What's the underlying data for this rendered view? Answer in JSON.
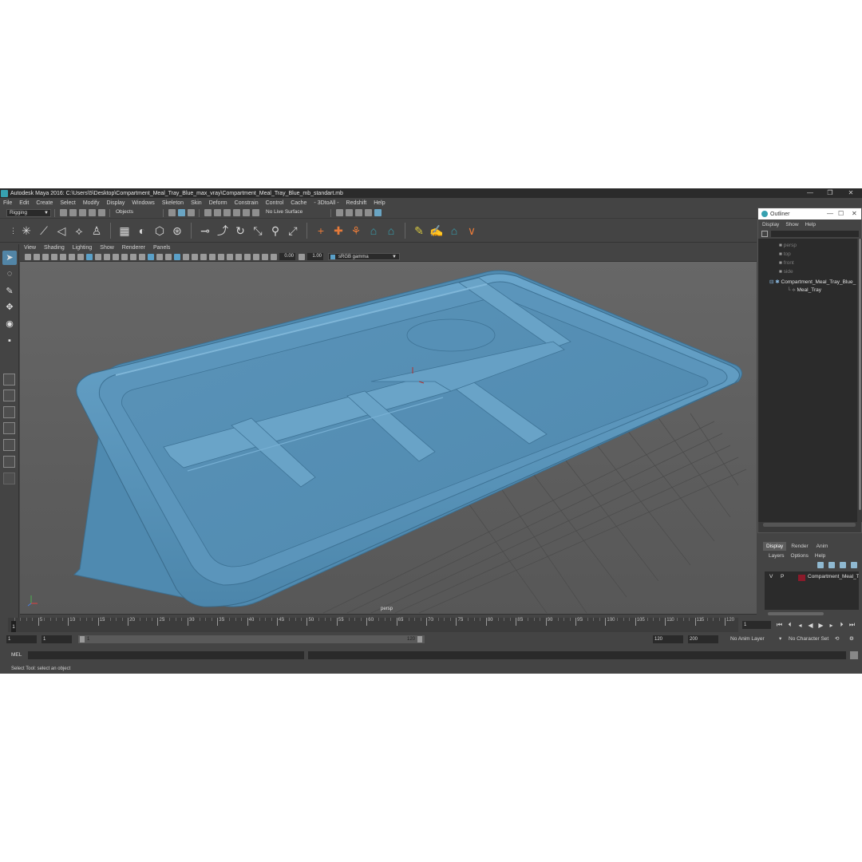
{
  "window": {
    "title": "Autodesk Maya 2016: C:\\Users\\5\\Desktop\\Compartment_Meal_Tray_Blue_max_vray\\Compartment_Meal_Tray_Blue_mb_standart.mb",
    "minimize": "—",
    "maximize": "❐",
    "close": "✕"
  },
  "menubar": [
    "File",
    "Edit",
    "Create",
    "Select",
    "Modify",
    "Display",
    "Windows",
    "Skeleton",
    "Skin",
    "Deform",
    "Constrain",
    "Control",
    "Cache",
    "- 3DtoAll -",
    "Redshift",
    "Help"
  ],
  "statusline": {
    "menuset": "Rigging",
    "selection_mode": "Objects",
    "live_surface": "No Live Surface"
  },
  "viewport": {
    "menus": [
      "View",
      "Shading",
      "Lighting",
      "Show",
      "Renderer",
      "Panels"
    ],
    "exposure": "0.00",
    "gamma": "1.00",
    "color_space": "sRGB gamma",
    "camera": "persp"
  },
  "outliner": {
    "title": "Outliner",
    "menus": [
      "Display",
      "Show",
      "Help"
    ],
    "items": [
      {
        "label": "persp",
        "dim": true
      },
      {
        "label": "top",
        "dim": true
      },
      {
        "label": "front",
        "dim": true
      },
      {
        "label": "side",
        "dim": true
      },
      {
        "label": "Compartment_Meal_Tray_Blue_",
        "dim": false
      },
      {
        "label": "Meal_Tray",
        "dim": false
      }
    ]
  },
  "layer_editor": {
    "tabs": [
      "Display",
      "Render",
      "Anim"
    ],
    "active_tab": "Display",
    "menus": [
      "Layers",
      "Options",
      "Help"
    ],
    "layer": {
      "visible": "V",
      "playback": "P",
      "color": "#8b1a2a",
      "name": "Compartment_Meal_Tr"
    }
  },
  "timeline": {
    "ticks": [
      "1",
      "5",
      "10",
      "15",
      "20",
      "25",
      "30",
      "35",
      "40",
      "45",
      "50",
      "55",
      "60",
      "65",
      "70",
      "75",
      "80",
      "85",
      "90",
      "95",
      "100",
      "105",
      "110",
      "115",
      "120"
    ],
    "current_frame": "1",
    "current_frame_field": "1"
  },
  "range": {
    "start": "1",
    "playback_start": "1",
    "handle_start": "1",
    "handle_end": "120",
    "playback_end": "120",
    "end": "200",
    "anim_layer": "No Anim Layer",
    "character_set": "No Character Set"
  },
  "commandline": {
    "language": "MEL"
  },
  "helpline": "Select Tool: select an object",
  "colors": {
    "tray": "#5a93b8",
    "accent": "#37a1b0",
    "active_tool": "#5285a6"
  }
}
